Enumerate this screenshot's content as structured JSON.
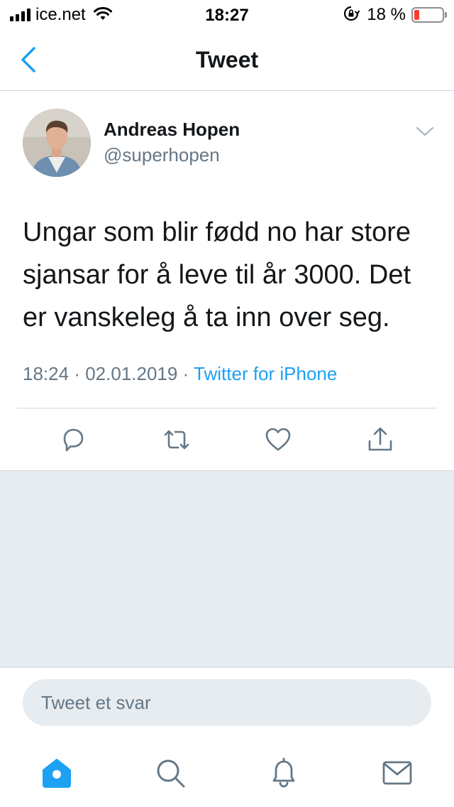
{
  "status_bar": {
    "carrier": "ice.net",
    "time": "18:27",
    "battery_percent": "18 %",
    "battery_level": 0.18,
    "icons": [
      "signal-icon",
      "wifi-icon",
      "rotation-lock-icon",
      "battery-icon"
    ]
  },
  "nav": {
    "title": "Tweet",
    "back_icon": "back-chevron-icon"
  },
  "tweet": {
    "author_name": "Andreas Hopen",
    "author_handle": "@superhopen",
    "text": "Ungar som blir fødd no har store sjansar for å leve til år 3000. Det er vanskeleg å ta inn over seg.",
    "time": "18:24",
    "date": "02.01.2019",
    "separator": "·",
    "source": "Twitter for iPhone",
    "actions": [
      "reply-icon",
      "retweet-icon",
      "like-icon",
      "share-icon"
    ]
  },
  "reply": {
    "placeholder": "Tweet et svar"
  },
  "tabs": [
    "home-icon",
    "search-icon",
    "notifications-icon",
    "messages-icon"
  ],
  "colors": {
    "accent": "#1da1f2",
    "secondary_text": "#657786",
    "background_gray": "#e6ecf0",
    "battery_low": "#ff3b30"
  }
}
